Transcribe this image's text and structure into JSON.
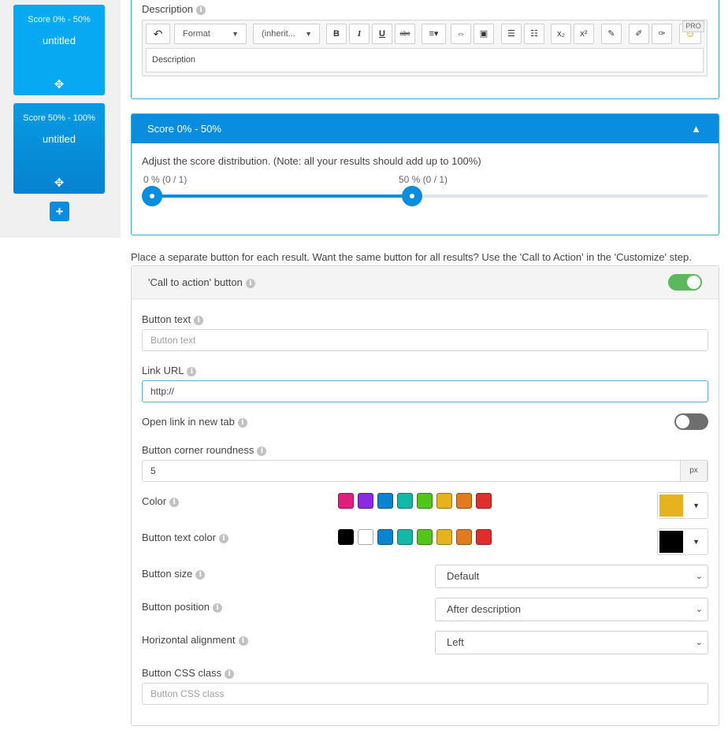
{
  "sidebar": {
    "cards": [
      {
        "title": "Score 0% - 50%",
        "name": "untitled",
        "move_icon": "✥"
      },
      {
        "title": "Score 50% - 100%",
        "name": "untitled",
        "move_icon": "✥"
      }
    ],
    "add_label": "+"
  },
  "description": {
    "label": "Description",
    "info_icon": "i",
    "toolbar": {
      "undo_icon": "↶",
      "format_label": "Format",
      "font_label": "(inherit...",
      "caret": "▼",
      "bold": "B",
      "italic": "I",
      "underline": "U",
      "strike": "abc",
      "align_icon": "≡▾",
      "link_icon": "⇔",
      "image_icon": "▣",
      "bullet_icon": "☰",
      "number_icon": "☷",
      "subscript": "x₂",
      "superscript": "x²",
      "clean_icon": "✎",
      "brush_icon": "✐",
      "brush2_icon": "✑",
      "emoji_icon": "☺",
      "pro_badge": "PRO"
    },
    "placeholder": "Description"
  },
  "score_range": {
    "header": "Score 0% - 50%",
    "collapse_icon": "▲",
    "note": "Adjust the score distribution. (Note: all your results should add up to 100%)",
    "start_label": "0 % (0 / 1)",
    "end_label": "50 % (0 / 1)",
    "start_value": 0,
    "end_value": 50
  },
  "separate_note": "Place a separate button for each result. Want the same button for all results? Use the 'Call to Action' in the 'Customize' step.",
  "cta": {
    "header": "'Call to action' button",
    "enabled": true,
    "button_text": {
      "label": "Button text",
      "placeholder": "Button text",
      "value": ""
    },
    "link_url": {
      "label": "Link URL",
      "value": "http://"
    },
    "new_tab": {
      "label": "Open link in new tab",
      "enabled": false
    },
    "roundness": {
      "label": "Button corner roundness",
      "value": "5",
      "unit": "px"
    },
    "color": {
      "label": "Color",
      "swatches": [
        "#e21e7b",
        "#8a2be2",
        "#0a84d0",
        "#14b8a6",
        "#52c41a",
        "#e6b31e",
        "#e07b1f",
        "#e02d2d"
      ],
      "selected": "#e6b31e"
    },
    "text_color": {
      "label": "Button text color",
      "swatches": [
        "#000000",
        "#ffffff",
        "#0a84d0",
        "#14b8a6",
        "#52c41a",
        "#e6b31e",
        "#e07b1f",
        "#e02d2d"
      ],
      "selected": "#000000"
    },
    "picker_caret": "▼",
    "size": {
      "label": "Button size",
      "value": "Default"
    },
    "position": {
      "label": "Button position",
      "value": "After description"
    },
    "alignment": {
      "label": "Horizontal alignment",
      "value": "Left"
    },
    "select_caret": "⌄",
    "css_class": {
      "label": "Button CSS class",
      "placeholder": "Button CSS class",
      "value": ""
    }
  }
}
